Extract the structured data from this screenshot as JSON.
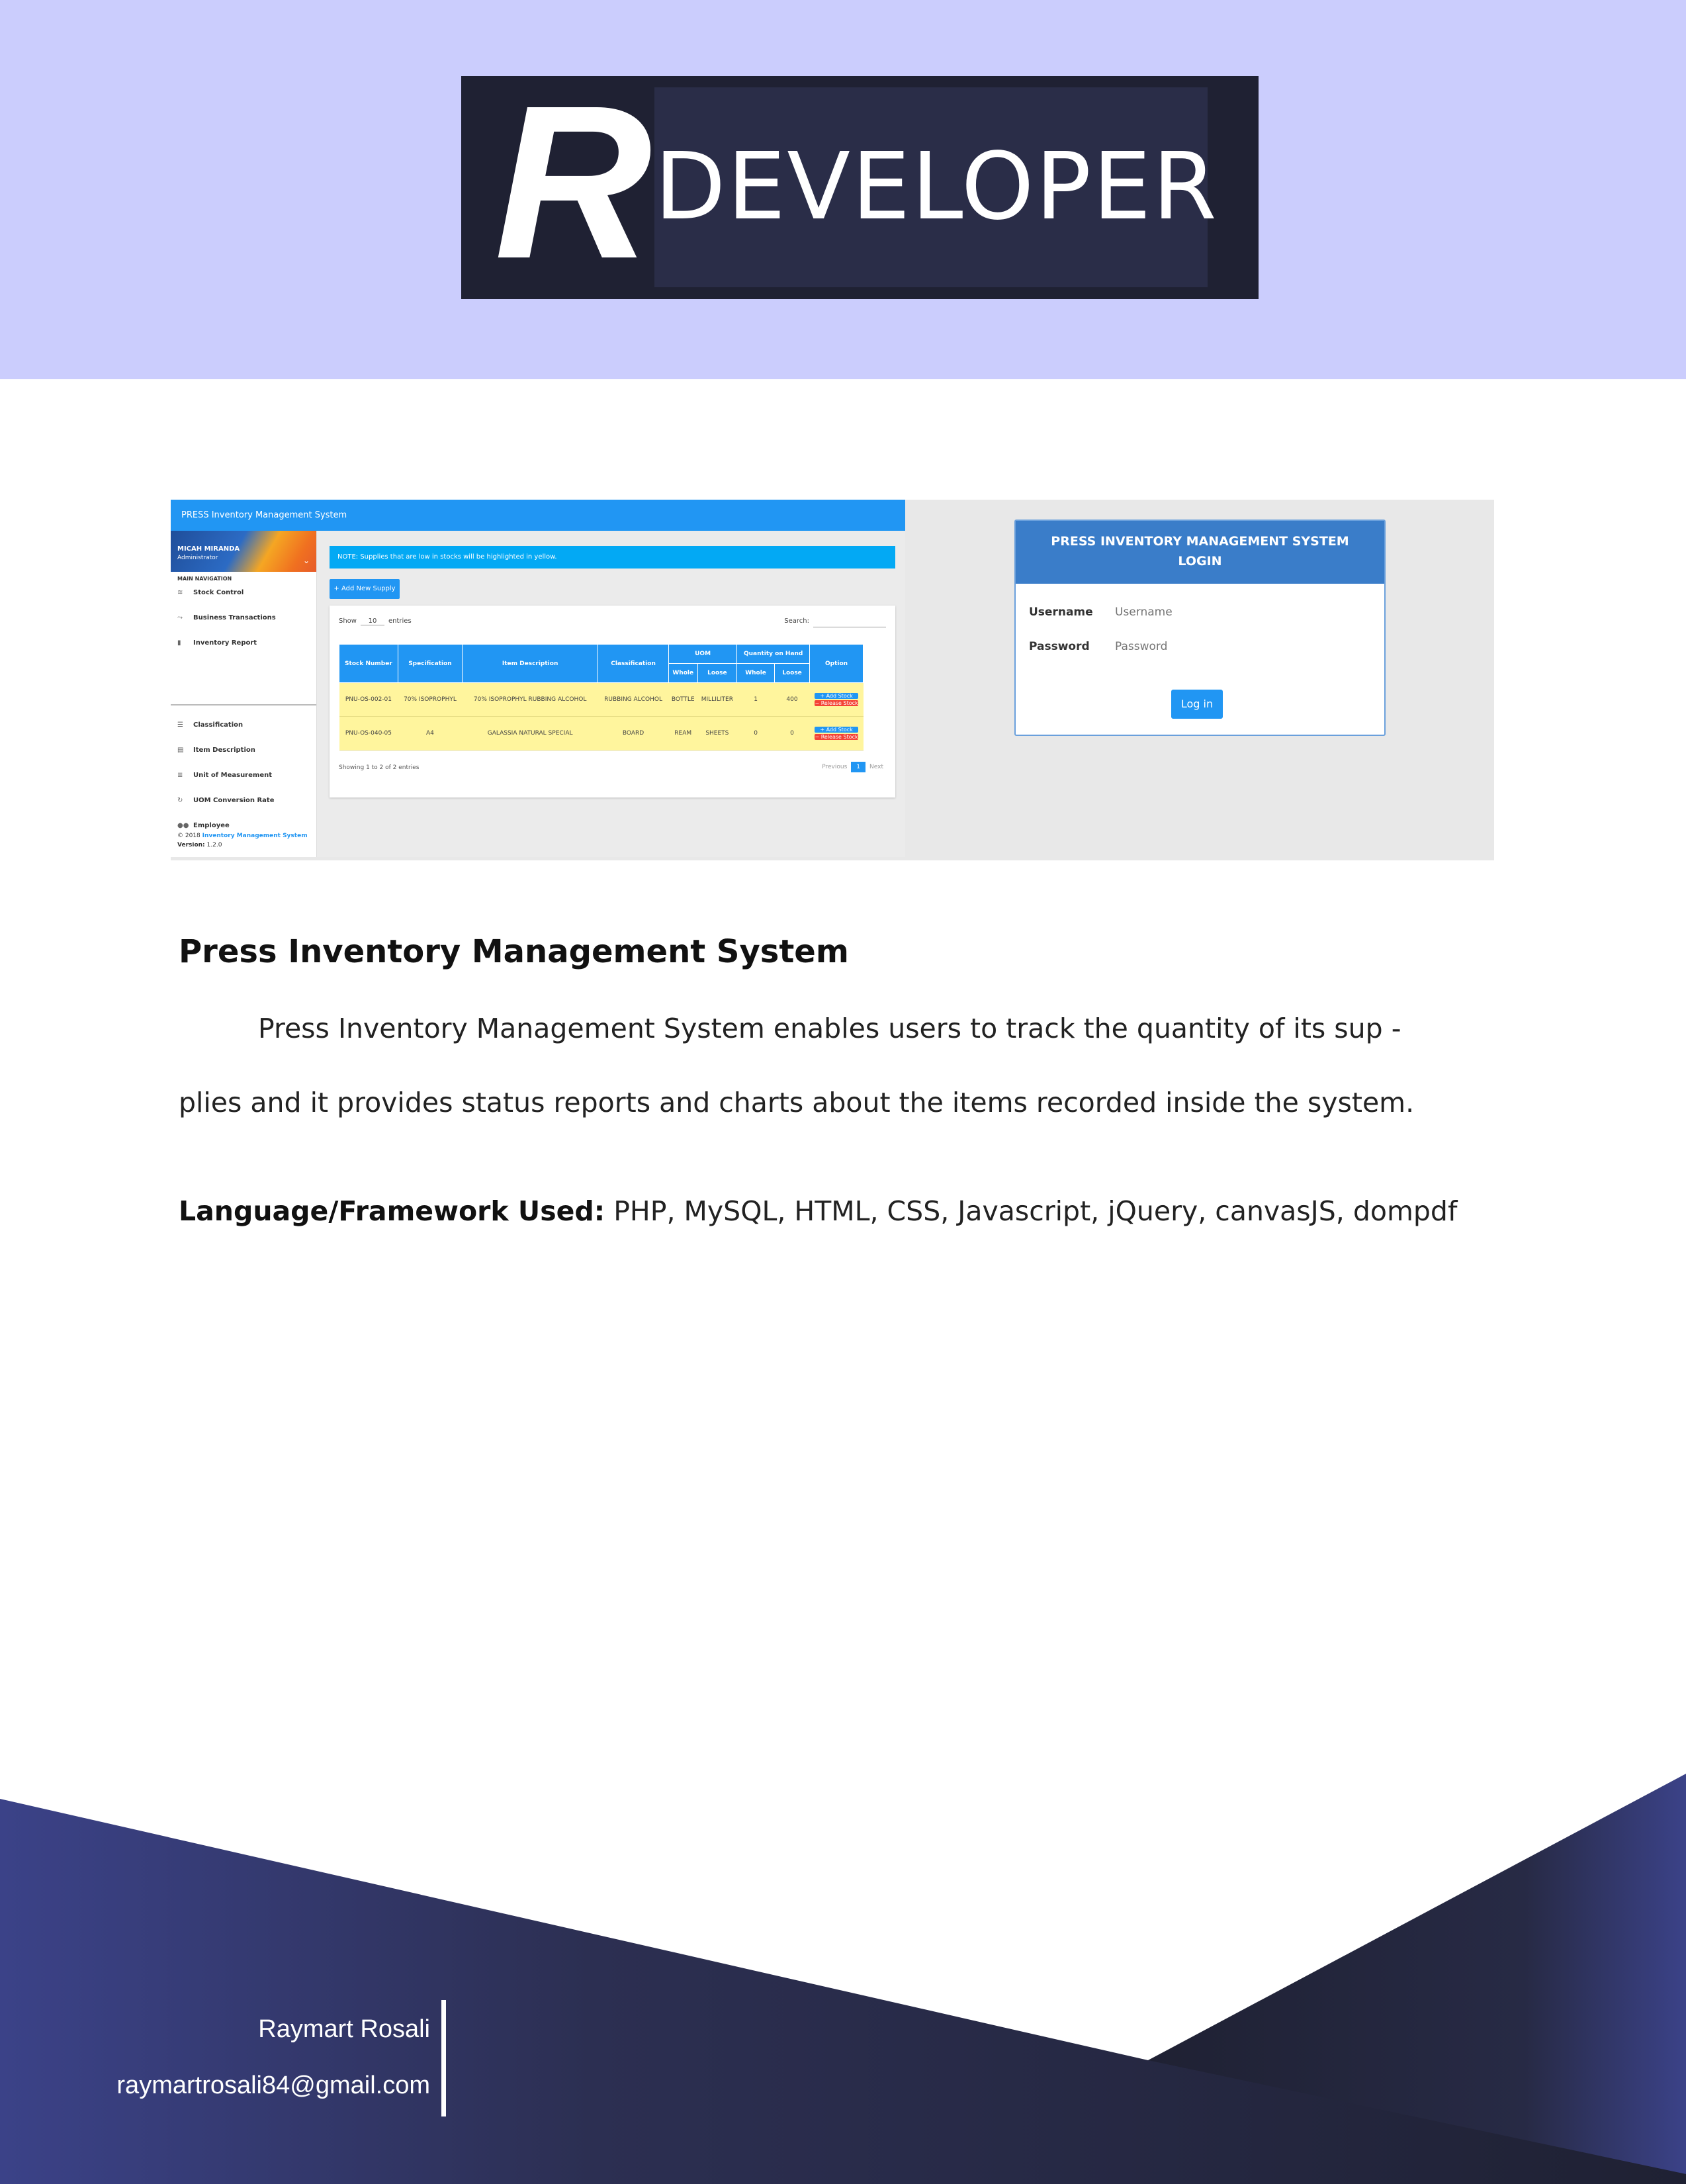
{
  "header": {
    "logo_letter": "R",
    "logo_word": "DEVELOPER",
    "bg_color": "#cbcdfd"
  },
  "screenshot": {
    "app_bar_title": "PRESS Inventory Management System",
    "sidebar": {
      "user_name": "MICAH MIRANDA",
      "user_role": "Administrator",
      "nav_label": "MAIN NAVIGATION",
      "items": [
        {
          "label": "Stock Control",
          "icon": "layers-icon"
        },
        {
          "label": "Business Transactions",
          "icon": "trend-icon"
        },
        {
          "label": "Inventory Report",
          "icon": "bar-chart-icon"
        },
        {
          "label": "Classification",
          "icon": "list-icon"
        },
        {
          "label": "Item Description",
          "icon": "clipboard-icon"
        },
        {
          "label": "Unit of Measurement",
          "icon": "list-numbered-icon"
        },
        {
          "label": "UOM Conversion Rate",
          "icon": "refresh-icon"
        },
        {
          "label": "Employee",
          "icon": "people-icon"
        }
      ],
      "footer_prefix": "© 2018",
      "footer_link": "Inventory Management System",
      "version_label": "Version:",
      "version": "1.2.0"
    },
    "note": "NOTE: Supplies that are low in stocks will be highlighted in yellow.",
    "add_button": "+ Add New Supply",
    "show_label": "Show",
    "show_value": "10",
    "entries_label": "entries",
    "search_label": "Search:",
    "table": {
      "headers": [
        "Stock Number",
        "Specification",
        "Item Description",
        "Classification",
        "UOM",
        "Quantity on Hand",
        "Option"
      ],
      "subheaders": [
        "Whole",
        "Loose",
        "Whole",
        "Loose"
      ],
      "rows": [
        [
          "PNU-OS-002-01",
          "70% ISOPROPHYL",
          "70% ISOPROPHYL RUBBING ALCOHOL",
          "RUBBING ALCOHOL",
          "BOTTLE",
          "MILLILITER",
          "1",
          "400"
        ],
        [
          "PNU-OS-040-05",
          "A4",
          "GALASSIA NATURAL SPECIAL",
          "BOARD",
          "REAM",
          "SHEETS",
          "0",
          "0"
        ]
      ],
      "add_stock": "+ Add Stock",
      "release_stock": "− Release Stock"
    },
    "showing": "Showing 1 to 2 of 2 entries",
    "pager": {
      "previous": "Previous",
      "current": "1",
      "next": "Next"
    },
    "login": {
      "title_line1": "PRESS INVENTORY MANAGEMENT SYSTEM",
      "title_line2": "LOGIN",
      "username_label": "Username",
      "username_placeholder": "Username",
      "password_label": "Password",
      "password_placeholder": "Password",
      "button": "Log in"
    }
  },
  "project": {
    "title": "Press Inventory Management System",
    "description_line1": "Press Inventory Management System enables users to track the quantity of its sup -",
    "description_line2": "plies and it provides status reports and charts about the items recorded inside the system.",
    "lang_label": "Language/Framework Used:",
    "lang_value": " PHP, MySQL, HTML, CSS, Javascript, jQuery, canvasJS, dompdf"
  },
  "footer": {
    "name": "Raymart Rosali",
    "email": "raymartrosali84@gmail.com",
    "colors": [
      "#2b2f55",
      "#1f2133",
      "#3b4288"
    ]
  }
}
